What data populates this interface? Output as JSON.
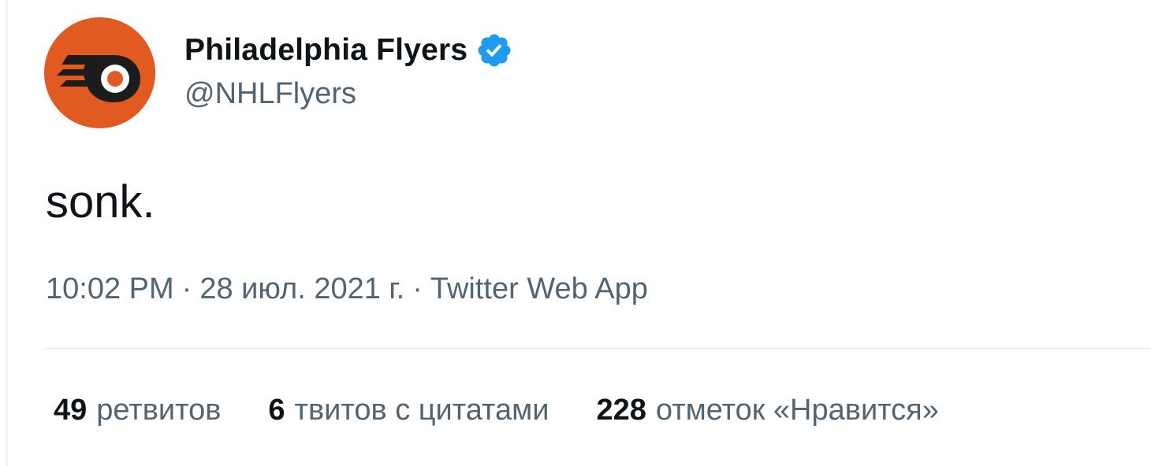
{
  "author": {
    "display_name": "Philadelphia Flyers",
    "handle": "@NHLFlyers",
    "verified": true,
    "avatar_icon": "flyers-logo-icon",
    "avatar_color": "#e05a22"
  },
  "tweet": {
    "text": "sonk."
  },
  "meta": {
    "time": "10:02 PM",
    "date": "28 июл. 2021 г.",
    "separator": "·",
    "source": "Twitter Web App"
  },
  "stats": [
    {
      "count": "49",
      "label": "ретвитов"
    },
    {
      "count": "6",
      "label": "твитов с цитатами"
    },
    {
      "count": "228",
      "label": "отметок «Нравится»"
    }
  ],
  "colors": {
    "primary_text": "#0f1419",
    "secondary_text": "#536471",
    "verified_blue": "#1d9bf0",
    "divider": "#eff3f4"
  }
}
